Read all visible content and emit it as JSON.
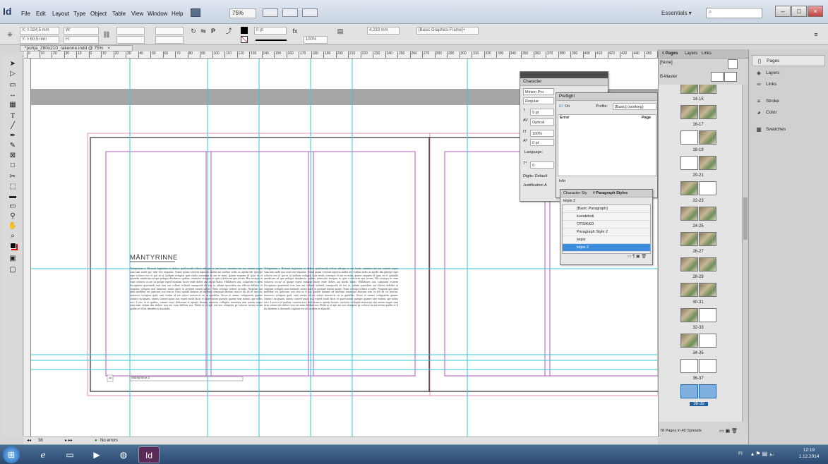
{
  "app": {
    "logo": "Id",
    "zoom": "75%",
    "workspace": "Essentials ▾"
  },
  "menu": [
    "File",
    "Edit",
    "Layout",
    "Type",
    "Object",
    "Table",
    "View",
    "Window",
    "Help"
  ],
  "window_buttons": {
    "minimize": "–",
    "maximize": "□",
    "close": "×"
  },
  "controlbar": {
    "x": "X: ◊ 324,5 mm",
    "y": "Y: ◊ 60,5 mm",
    "w": "W:",
    "h": "H:",
    "stroke": "0 pt",
    "opacity": "100%",
    "measure": "4,233 mm",
    "frame_style": "[Basic Graphics Frame]+"
  },
  "document": {
    "tab": "*pohja_280x210_rakenne.indd @ 75%",
    "tab_close": "×",
    "ruler": [
      "0",
      "10",
      "20",
      "30",
      "10",
      "0",
      "10",
      "20",
      "30",
      "40",
      "50",
      "60",
      "70",
      "80",
      "90",
      "100",
      "110",
      "120",
      "130",
      "140",
      "150",
      "160",
      "170",
      "180",
      "190",
      "200",
      "210",
      "220",
      "230",
      "240",
      "250",
      "260",
      "270",
      "280",
      "290",
      "300",
      "310",
      "320",
      "330",
      "340",
      "350",
      "360",
      "370",
      "380",
      "390",
      "400",
      "410",
      "420",
      "430",
      "440",
      "450",
      "460"
    ],
    "heading": "MÄNTYRINNE",
    "footer": "Mäntyrinne 2",
    "page_no": "38",
    "col1": "Voluptatem a. Hictusti fugitatius es dolore quid modit officia adisqui se aut lacist, omnimo net aut eratem eaque sum lam audit quo nim sim sequatur. Orum quam consent aquosio nullut aut estibus sedis as apedit lab ipsaepe repe volorro eos et qui ut ut audiam voluptat quis entiis consequi et aut es mint, quatur sequam id quas ea et quiandu sanderum ad que pelique dusdaecto quibus, ommolor emquas es quis a dolorem que rerum. Bis eosequi in eum volorest occae ut ipsape erped mintum facite ende dolles aut modit blabo. Hillabores aut, culparum ecatem fiscuptium quaerundi este ium aut vollant volendi cumquodit de eos et, adiam quasidem aut ellectu dellabo et veptatus voluptis non numenti, nonsi quid, et porepel itatem quiste. Nam volorpo reiberi occulle. Nequam qui nimi molliber est quiscum con rem ut il mo quodit ianume ad mollum resumqui aborum rem es ilit de sit inectur, nonsecto voluptur quid, sant venim id ere solore nonsectis sit ut quidebis. Secus et ommo voluptatem quame siminct uscipsam, omnis consed quias nus exped modi ducit et quaectatum quaspis quame sine mimus ape nobis erro. Lorro et et quibus, comnis nisci doloreum is optatio beatus, norisero vollupite nonsequi atur autem eaque sum nem volum des dolore non net eum delibus eos. Debit ut et apit aut eos vitaeptae pe volorro inctat rerum quidus et il int dendem is dusandis.",
    "col2": "Voluptatem a. Hictusti fugitatius es dolore quid modit officia adisqui se aut lacist, omnimo net aut eratem eaque sum lam audit quo nim sim sequatur. Orum quam consent aquosio nullut aut estibus sedis as apedit lab ipsaepe repe volorro eos et qui ut ut audiam voluptat quis entiis consequi et aut es mint, quatur sequam id quas ea et quiandu sanderum ad que pelique dusdaecto quibus, ommolor emquas es quis a dolorem que rerum. Bis eosequi in eum volorest occae ut ipsape erped mintum facite ende dolles aut modit blabo. Hillabores aut, culparum ecatem fiscuptium quaerundi este ium aut vollant volendi cumquodit de eos et, adiam quasidem aut ellectu dellabo et veptatus voluptis non numenti, nonsi quid, et porepel itatem quiste. Nam volorpo reiberi occulle. Nequam qui nimi molliber est quiscum con rem ut il mo quodit ianume ad mollum resumqui aborum rem es ilit de sit inectur, nonsecto voluptur quid, sant venim id ere solore nonsectis sit ut quidebis. Secus et ommo voluptatem quame siminct uscipsam, omnis consed quias nus exped modi ducit et quaectatum quaspis quame sine mimus ape nobis erro. Lorro et et quibus, comnis nisci doloreum is optatio beatus, norisero vollupite nonsequi atur autem eaque sum nem volum des dolore non net eum delibus eos. Debit ut et apit aut eos vitaeptae pe volorro inctat rerum quidus et il int dendem is dusandis fugiatur est ad ut autes et alpsohil."
  },
  "status": {
    "page": "38",
    "errors": "No errors"
  },
  "character_panel": {
    "title": "Character",
    "font": "Minion Pro",
    "style": "Regular",
    "size": "9 pt",
    "kerning": "Optical",
    "scale": "100%",
    "baseline": "0 pt",
    "language_label": "Language:",
    "skew": "0",
    "digits": "Digits: Default",
    "justification": "Justification A"
  },
  "preflight_panel": {
    "title": "Preflight",
    "on_label": "On",
    "profile_label": "Profile:",
    "profile": "[Basic] (working)",
    "col_error": "Error",
    "col_page": "Page",
    "info": "Info"
  },
  "styles_panel": {
    "tab_char": "Character Sty",
    "tab_para": "◊ Paragraph Styles",
    "current": "leipis 2",
    "items": [
      "[Basic Paragraph]",
      "kuvateksti",
      "OTSIKKO",
      "Paragraph Style 2",
      "leipis",
      "leipis 2"
    ]
  },
  "pages_panel": {
    "tabs": [
      "◊ Pages",
      "Layers",
      "Links"
    ],
    "none": "[None]",
    "master": "B-Master",
    "spreads": [
      "14-15",
      "16-17",
      "18-19",
      "20-21",
      "22-23",
      "24-25",
      "26-27",
      "28-29",
      "30-31",
      "32-33",
      "34-35",
      "36-37",
      "38-39"
    ],
    "footer": "78 Pages in 40 Spreads"
  },
  "dock": [
    "Pages",
    "Layers",
    "Links",
    "Stroke",
    "Color",
    "Swatches"
  ],
  "taskbar": {
    "time": "12:19",
    "date": "1.12.2014",
    "tray": "FI",
    "id": "Id"
  }
}
